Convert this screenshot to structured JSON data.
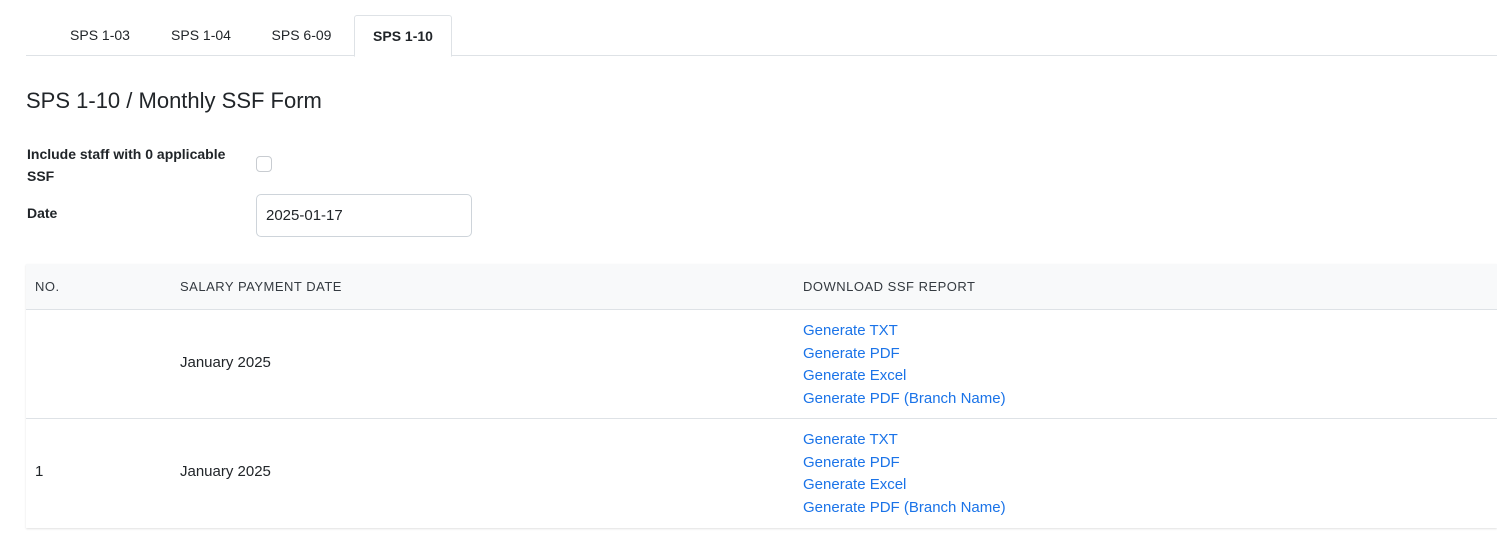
{
  "tabs": [
    {
      "label": "SPS 1-03",
      "active": false
    },
    {
      "label": "SPS 1-04",
      "active": false
    },
    {
      "label": "SPS 6-09",
      "active": false
    },
    {
      "label": "SPS 1-10",
      "active": true
    }
  ],
  "page_title": "SPS 1-10 / Monthly SSF Form",
  "form": {
    "include_staff_label_line1": "Include staff with 0 applicable",
    "include_staff_label_line2": "SSF",
    "include_staff_checked": false,
    "date_label": "Date",
    "date_value": "2025-01-17"
  },
  "table": {
    "headers": {
      "no": "NO.",
      "salary_payment_date": "SALARY PAYMENT DATE",
      "download_ssf_report": "DOWNLOAD SSF REPORT"
    },
    "rows": [
      {
        "no": "",
        "salary_payment_date": "January 2025",
        "links": [
          "Generate TXT",
          "Generate PDF",
          "Generate Excel",
          "Generate PDF (Branch Name)"
        ]
      },
      {
        "no": "1",
        "salary_payment_date": "January 2025",
        "links": [
          "Generate TXT",
          "Generate PDF",
          "Generate Excel",
          "Generate PDF (Branch Name)"
        ]
      }
    ]
  },
  "colors": {
    "link": "#1a73e8",
    "border": "#dee2e6",
    "header_bg": "#f8f9fa"
  }
}
